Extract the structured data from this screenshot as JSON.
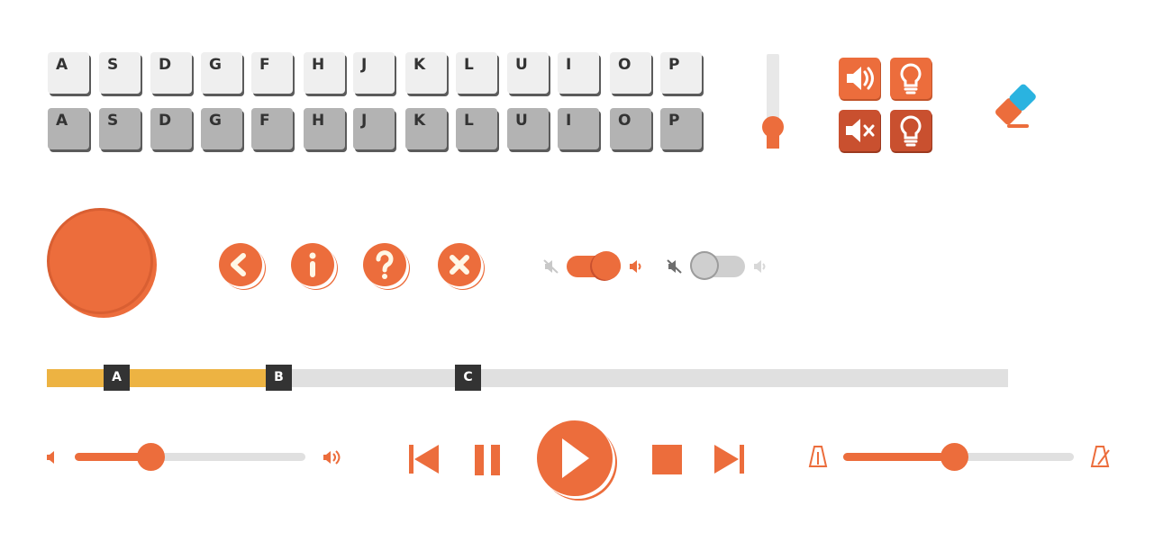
{
  "colors": {
    "accent": "#ec6d3c",
    "accent_dark": "#c9502f",
    "progress": "#edb342",
    "track": "#e0e0e0",
    "key_light": "#efefef",
    "key_dark": "#b3b3b3",
    "marker": "#333333",
    "eraser_blue": "#2ab3e0"
  },
  "keyboard": {
    "row_light": [
      "A",
      "S",
      "D",
      "G",
      "F",
      "H",
      "J",
      "K",
      "L",
      "U",
      "I",
      "O",
      "P"
    ],
    "row_dark": [
      "A",
      "S",
      "D",
      "G",
      "F",
      "H",
      "J",
      "K",
      "L",
      "U",
      "I",
      "O",
      "P"
    ]
  },
  "vertical_slider": {
    "value": 0.2
  },
  "icon_buttons": [
    {
      "icon": "sound-on-icon"
    },
    {
      "icon": "lightbulb-icon"
    },
    {
      "icon": "sound-off-icon"
    },
    {
      "icon": "lightbulb-icon"
    }
  ],
  "eraser": {
    "icon": "eraser-icon"
  },
  "circle_buttons": [
    {
      "icon": "back-arrow-icon"
    },
    {
      "icon": "info-icon"
    },
    {
      "icon": "help-icon"
    },
    {
      "icon": "close-icon"
    }
  ],
  "toggles": [
    {
      "state": "on"
    },
    {
      "state": "off"
    }
  ],
  "progress": {
    "fill": 0.23,
    "markers": [
      {
        "label": "A"
      },
      {
        "label": "B"
      },
      {
        "label": "C"
      }
    ]
  },
  "volume_slider": {
    "value": 0.33
  },
  "transport": {
    "buttons": [
      "skip-back-icon",
      "pause-icon",
      "play-icon",
      "stop-icon",
      "skip-forward-icon"
    ]
  },
  "tempo_slider": {
    "value": 0.48
  }
}
